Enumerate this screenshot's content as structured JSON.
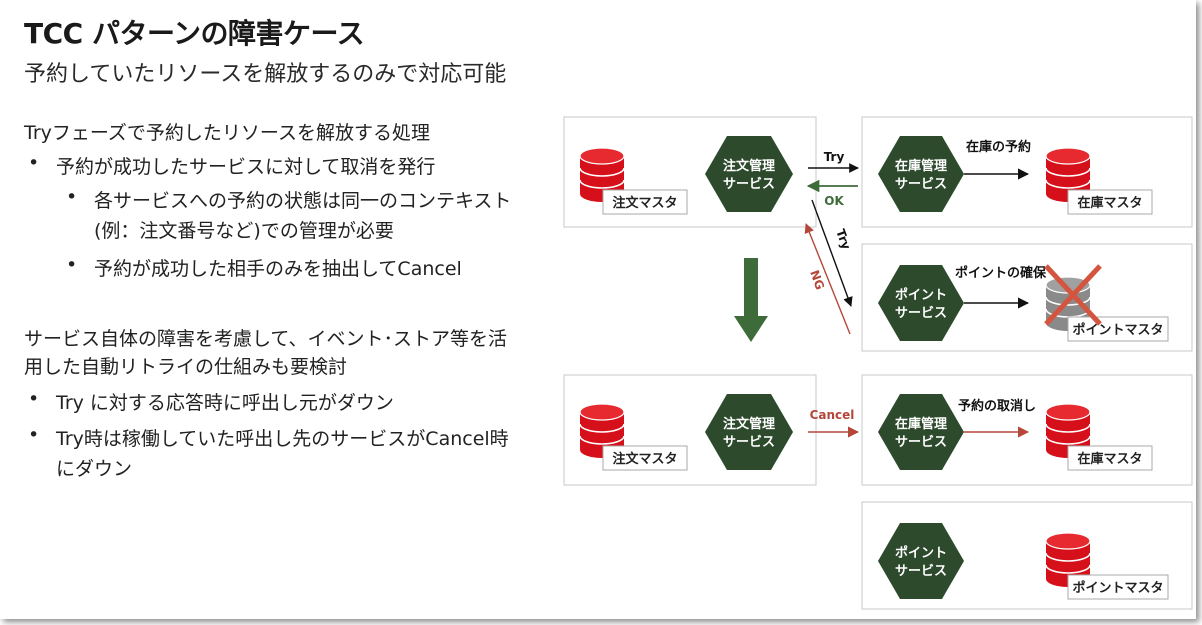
{
  "title": "TCC パターンの障害ケース",
  "subtitle": "予約していたリソースを解放するのみで対応可能",
  "section1": {
    "heading": "Tryフェーズで予約したリソースを解放する処理",
    "bullet1": "予約が成功したサービスに対して取消を発行",
    "sub1_line1": "各サービスへの予約の状態は同一のコンテキスト",
    "sub1_line2": "(例：注文番号など)での管理が必要",
    "sub2": "予約が成功した相手のみを抽出してCancel"
  },
  "section2": {
    "heading_line1": "サービス自体の障害を考慮して、イベント･ストア等を活",
    "heading_line2": "用した自動リトライの仕組みも要検討",
    "bullet1": "Try に対する応答時に呼出し元がダウン",
    "bullet2_line1": "Try時は稼働していた呼出し先のサービスがCancel時",
    "bullet2_line2": "にダウン"
  },
  "diagram": {
    "order_service": "注文管理\nサービス",
    "inventory_service": "在庫管理\nサービス",
    "point_service": "ポイント\nサービス",
    "order_master": "注文マスタ",
    "inventory_master": "在庫マスタ",
    "point_master": "ポイントマスタ",
    "try_label": "Try",
    "ok_label": "OK",
    "try_diag_label": "Try",
    "ng_label": "NG",
    "cancel_label": "Cancel",
    "reserve_inventory": "在庫の予約",
    "reserve_points": "ポイントの確保",
    "cancel_reservation": "予約の取消し"
  },
  "colors": {
    "hexagon": "#2d4a2d",
    "database_red": "#d6101a",
    "database_gray": "#888888",
    "arrow_green": "#3e6b3a",
    "arrow_red": "#b5473a",
    "x_mark": "#d4553f"
  }
}
